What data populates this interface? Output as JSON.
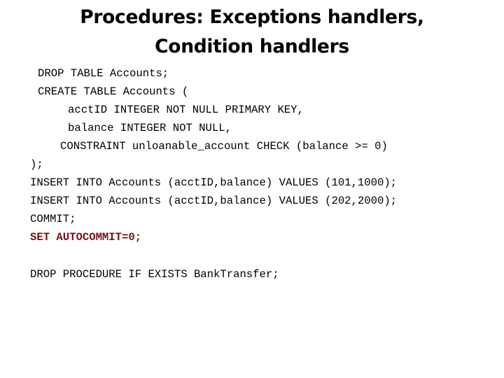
{
  "slide": {
    "title_lines": [
      "Procedures: Exceptions handlers,",
      "Condition handlers"
    ],
    "highlight_color": "#7a0f12",
    "code_lines": [
      {
        "text": "DROP TABLE Accounts;"
      },
      {
        "text": "CREATE TABLE Accounts ("
      },
      {
        "text": "acctID INTEGER NOT NULL PRIMARY KEY,"
      },
      {
        "text": "balance INTEGER NOT NULL,"
      },
      {
        "text": "CONSTRAINT unloanable_account CHECK (balance >= 0)"
      },
      {
        "text": ");"
      },
      {
        "text": "INSERT INTO Accounts (acctID,balance) VALUES (101,1000);"
      },
      {
        "text": "INSERT INTO Accounts (acctID,balance) VALUES (202,2000);"
      },
      {
        "text": "COMMIT;"
      },
      {
        "text": "SET AUTOCOMMIT=0;",
        "highlight": true
      },
      {
        "text": ""
      },
      {
        "text": "DROP PROCEDURE IF EXISTS BankTransfer;"
      }
    ]
  }
}
